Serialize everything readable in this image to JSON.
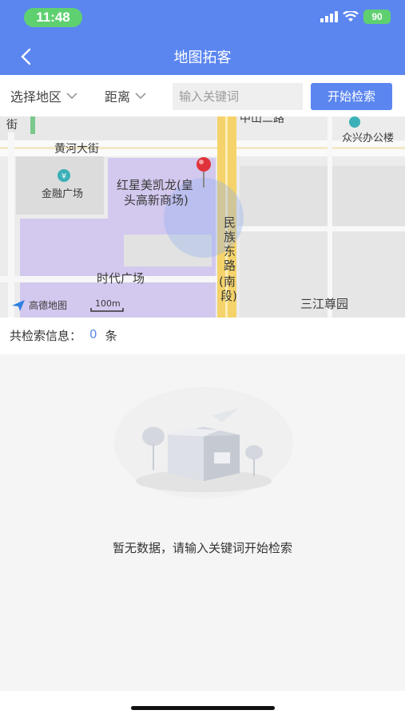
{
  "status_bar": {
    "time": "11:48",
    "battery": "90"
  },
  "header": {
    "title": "地图拓客"
  },
  "filters": {
    "region_label": "选择地区",
    "distance_label": "距离",
    "keyword_placeholder": "输入关键词",
    "search_label": "开始检索"
  },
  "map": {
    "labels": {
      "street_top_left": "街",
      "road_top": "中山二路",
      "zhongxing": "众兴办公楼",
      "huanghe": "黄河大街",
      "jinrong": "金融广场",
      "hongxing": "红星美凯龙(皇",
      "hongxing2": "头高新商场)",
      "shidai": "时代广场",
      "minzu1": "民",
      "minzu2": "族",
      "minzu3": "东",
      "minzu4": "路",
      "minzu5": "(南",
      "minzu6": "段)",
      "sanjiang": "三江尊园"
    },
    "logo_text": "高德地图",
    "scale": "100m"
  },
  "results": {
    "label": "共检索信息：",
    "count": "0",
    "unit": "条"
  },
  "empty": {
    "message": "暂无数据，请输入关键词开始检索"
  },
  "colors": {
    "accent": "#5b86f0",
    "status_green": "#5fd070"
  }
}
